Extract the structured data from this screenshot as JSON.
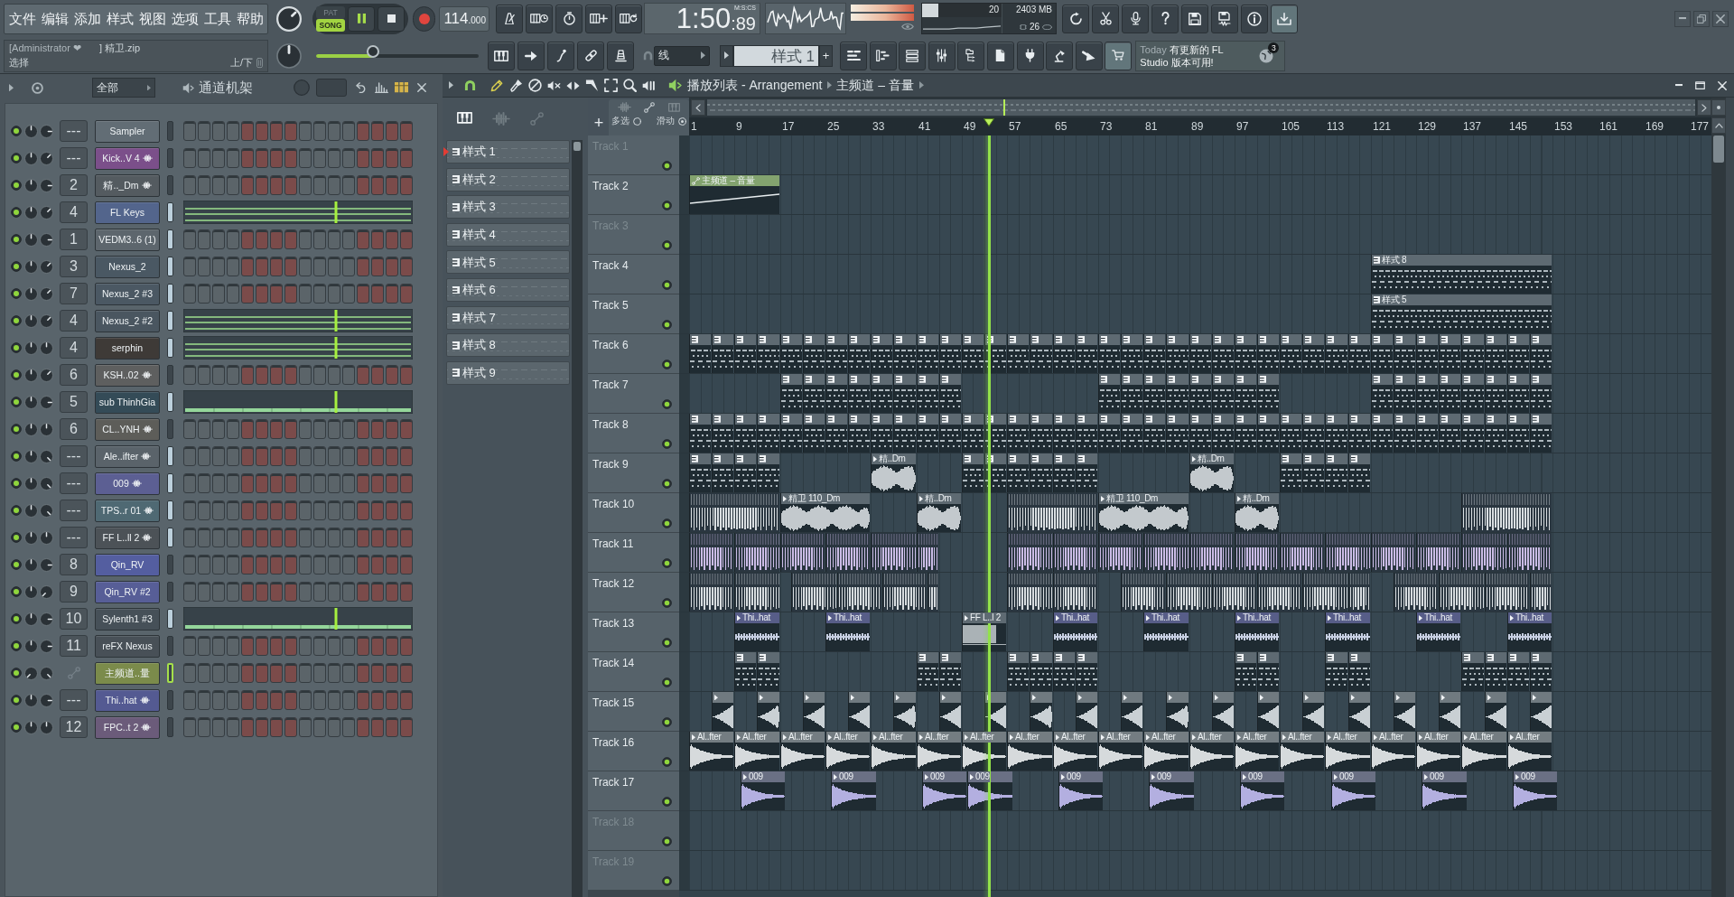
{
  "menu": [
    "文件",
    "编辑",
    "添加",
    "样式",
    "视图",
    "选项",
    "工具",
    "帮助"
  ],
  "hint": {
    "user": "[Administrator ❤",
    "file": "] 精卫.zip",
    "action": "选择",
    "keys": "上/下"
  },
  "master_volume": {
    "kind": "northeast"
  },
  "master_pitch": {
    "kind": "north"
  },
  "master_slider": {
    "level": 0.35
  },
  "transport": {
    "modes": [
      {
        "label": "PAT",
        "selected": false
      },
      {
        "label": "SONG",
        "selected": true
      }
    ],
    "playing": true
  },
  "tempo": {
    "value": "114",
    "fraction": ".000"
  },
  "time": {
    "value": "1:50",
    "fraction": ":89",
    "unit": "M:S:CS"
  },
  "peak_meters": [
    {
      "level": 1
    },
    {
      "level": 1
    }
  ],
  "cpu": {
    "level": 0.2,
    "value": "20",
    "memory": "2403 MB",
    "polyphony": "26"
  },
  "download_button": {
    "highlighted": true
  },
  "store_button": {
    "highlighted": true
  },
  "snap": {
    "value": "线"
  },
  "pattern_picker": {
    "value": "样式 1",
    "add": "+"
  },
  "news": {
    "when": "Today",
    "message": "有更新的 FL Studio 版本可用!",
    "count": "3"
  },
  "channel_rack": {
    "filter": "全部",
    "title": "通道机架",
    "position": {
      "level": 0.67
    },
    "channels": [
      {
        "name": "Sampler",
        "kind": "instrument",
        "mixer": "---",
        "color": "#626d75",
        "enabled": true,
        "pan": {
          "kind": "north"
        },
        "volume": {
          "kind": "east"
        },
        "selected": false,
        "focused": false,
        "preview": {
          "kind": "steps"
        }
      },
      {
        "name": "Kick..V 4",
        "kind": "sample",
        "mixer": "---",
        "color": "#7b4f8a",
        "enabled": true,
        "pan": {
          "kind": "north"
        },
        "volume": {
          "kind": "northeast"
        },
        "selected": false,
        "focused": false,
        "preview": {
          "kind": "steps"
        }
      },
      {
        "name": "精.._Dm",
        "kind": "sample",
        "mixer": "2",
        "color": "#545b60",
        "enabled": true,
        "pan": {
          "kind": "north"
        },
        "volume": {
          "kind": "east"
        },
        "selected": false,
        "focused": false,
        "preview": {
          "kind": "steps"
        }
      },
      {
        "name": "FL Keys",
        "kind": "instrument",
        "mixer": "4",
        "color": "#53658c",
        "enabled": true,
        "pan": {
          "kind": "north"
        },
        "volume": {
          "kind": "northeast"
        },
        "selected": true,
        "focused": false,
        "preview": {
          "kind": "chords"
        }
      },
      {
        "name": "VEDM3..6 (1)",
        "kind": "instrument",
        "mixer": "1",
        "color": "#5d666d",
        "enabled": true,
        "pan": {
          "kind": "north"
        },
        "volume": {
          "kind": "east"
        },
        "selected": true,
        "focused": false,
        "preview": {
          "kind": "steps"
        }
      },
      {
        "name": "Nexus_2",
        "kind": "instrument",
        "mixer": "3",
        "color": "#4a5863",
        "enabled": true,
        "pan": {
          "kind": "north"
        },
        "volume": {
          "kind": "northeast"
        },
        "selected": true,
        "focused": false,
        "preview": {
          "kind": "steps"
        }
      },
      {
        "name": "Nexus_2 #3",
        "kind": "instrument",
        "mixer": "7",
        "color": "#4b5863",
        "enabled": true,
        "pan": {
          "kind": "north"
        },
        "volume": {
          "kind": "northeast"
        },
        "selected": true,
        "focused": false,
        "preview": {
          "kind": "steps"
        }
      },
      {
        "name": "Nexus_2 #2",
        "kind": "instrument",
        "mixer": "4",
        "color": "#4a5660",
        "enabled": true,
        "pan": {
          "kind": "north"
        },
        "volume": {
          "kind": "northeast"
        },
        "selected": true,
        "focused": false,
        "preview": {
          "kind": "chords"
        }
      },
      {
        "name": "serphin",
        "kind": "instrument",
        "mixer": "4",
        "color": "#3e3a37",
        "enabled": true,
        "pan": {
          "kind": "north"
        },
        "volume": {
          "kind": "north"
        },
        "selected": true,
        "focused": false,
        "preview": {
          "kind": "chords"
        }
      },
      {
        "name": "KSH..02",
        "kind": "sample",
        "mixer": "6",
        "color": "#5e5f5f",
        "enabled": true,
        "pan": {
          "kind": "north"
        },
        "volume": {
          "kind": "northeast"
        },
        "selected": false,
        "focused": false,
        "preview": {
          "kind": "steps"
        }
      },
      {
        "name": "sub ThinhGia",
        "kind": "instrument",
        "mixer": "5",
        "color": "#344b57",
        "enabled": true,
        "pan": {
          "kind": "north"
        },
        "volume": {
          "kind": "east"
        },
        "selected": true,
        "focused": false,
        "preview": {
          "kind": "bass"
        }
      },
      {
        "name": "CL..YNH",
        "kind": "sample",
        "mixer": "6",
        "color": "#5d5d59",
        "enabled": true,
        "pan": {
          "kind": "north"
        },
        "volume": {
          "kind": "north"
        },
        "selected": false,
        "focused": false,
        "preview": {
          "kind": "steps"
        }
      },
      {
        "name": "Ale..ifter",
        "kind": "sample",
        "mixer": "---",
        "color": "#5a636a",
        "enabled": true,
        "pan": {
          "kind": "north"
        },
        "volume": {
          "kind": "southeast"
        },
        "selected": true,
        "focused": false,
        "preview": {
          "kind": "steps"
        }
      },
      {
        "name": "009",
        "kind": "sample",
        "mixer": "---",
        "color": "#5c5f93",
        "enabled": true,
        "pan": {
          "kind": "north"
        },
        "volume": {
          "kind": "southeast"
        },
        "selected": true,
        "focused": false,
        "preview": {
          "kind": "steps"
        }
      },
      {
        "name": "TPS..r 01",
        "kind": "sample",
        "mixer": "---",
        "color": "#4f6973",
        "enabled": true,
        "pan": {
          "kind": "north"
        },
        "volume": {
          "kind": "southeast"
        },
        "selected": true,
        "focused": false,
        "preview": {
          "kind": "steps"
        }
      },
      {
        "name": "FF L..ll 2",
        "kind": "sample",
        "mixer": "---",
        "color": "#4c5257",
        "enabled": true,
        "pan": {
          "kind": "north"
        },
        "volume": {
          "kind": "north"
        },
        "selected": true,
        "focused": false,
        "preview": {
          "kind": "steps"
        }
      },
      {
        "name": "Qin_RV",
        "kind": "instrument",
        "mixer": "8",
        "color": "#545ea0",
        "enabled": true,
        "pan": {
          "kind": "north"
        },
        "volume": {
          "kind": "east"
        },
        "selected": false,
        "focused": false,
        "preview": {
          "kind": "steps"
        }
      },
      {
        "name": "Qin_RV #2",
        "kind": "instrument",
        "mixer": "9",
        "color": "#575e97",
        "enabled": true,
        "pan": {
          "kind": "north"
        },
        "volume": {
          "kind": "southwest"
        },
        "selected": false,
        "focused": false,
        "preview": {
          "kind": "steps"
        }
      },
      {
        "name": "Sylenth1 #3",
        "kind": "instrument",
        "mixer": "10",
        "color": "#465058",
        "enabled": true,
        "pan": {
          "kind": "north"
        },
        "volume": {
          "kind": "east"
        },
        "selected": true,
        "focused": false,
        "preview": {
          "kind": "bass"
        }
      },
      {
        "name": "reFX Nexus",
        "kind": "instrument",
        "mixer": "11",
        "color": "#485057",
        "enabled": true,
        "pan": {
          "kind": "north"
        },
        "volume": {
          "kind": "east"
        },
        "selected": false,
        "focused": false,
        "preview": {
          "kind": "steps"
        }
      },
      {
        "name": "主频道..量",
        "kind": "automation",
        "color": "#7b8b4b",
        "enabled": true,
        "pan": {
          "kind": "southwest"
        },
        "volume": {
          "kind": "southeast"
        },
        "selected": false,
        "focused": true,
        "preview": {
          "kind": "steps"
        }
      },
      {
        "name": "Thi..hat",
        "kind": "sample",
        "mixer": "---",
        "color": "#545a92",
        "enabled": true,
        "pan": {
          "kind": "north"
        },
        "volume": {
          "kind": "east"
        },
        "selected": false,
        "focused": false,
        "preview": {
          "kind": "steps"
        }
      },
      {
        "name": "FPC..t 2",
        "kind": "sample",
        "mixer": "12",
        "color": "#6b5b7a",
        "enabled": true,
        "pan": {
          "kind": "north"
        },
        "volume": {
          "kind": "north"
        },
        "selected": false,
        "focused": false,
        "preview": {
          "kind": "steps"
        }
      }
    ]
  },
  "playlist": {
    "title": "播放列表 - Arrangement",
    "breadcrumb": "主频道 – 音量",
    "tools": [
      {
        "kind": "draw",
        "selected": true
      },
      {
        "kind": "paint",
        "selected": false
      },
      {
        "kind": "delete",
        "selected": false
      },
      {
        "kind": "mute",
        "selected": false
      },
      {
        "kind": "slip",
        "selected": false
      },
      {
        "kind": "slice",
        "selected": false
      },
      {
        "kind": "select",
        "selected": false
      },
      {
        "kind": "zoom",
        "selected": false
      },
      {
        "kind": "playback",
        "selected": false
      }
    ],
    "filters": [
      {
        "kind": "pattern",
        "selected": true
      },
      {
        "kind": "audio",
        "selected": false
      },
      {
        "kind": "automation",
        "selected": false
      }
    ],
    "patterns": [
      {
        "name": "样式 1",
        "selected": true
      },
      {
        "name": "样式 2",
        "selected": false
      },
      {
        "name": "样式 3",
        "selected": false
      },
      {
        "name": "样式 4",
        "selected": false
      },
      {
        "name": "样式 5",
        "selected": false
      },
      {
        "name": "样式 6",
        "selected": false
      },
      {
        "name": "样式 7",
        "selected": false
      },
      {
        "name": "样式 8",
        "selected": false
      },
      {
        "name": "样式 9",
        "selected": false
      }
    ],
    "add_track": "+",
    "multi_select": "多选",
    "slide": "滑动",
    "ruler": [
      "1",
      "9",
      "17",
      "25",
      "33",
      "41",
      "49",
      "57",
      "65",
      "73",
      "81",
      "89",
      "97",
      "105",
      "113",
      "121",
      "129",
      "137",
      "145",
      "153",
      "161",
      "169",
      "177"
    ],
    "song_position": {
      "level": 0.3
    },
    "tracks": [
      {
        "name": "Track 1",
        "enabled": true
      },
      {
        "name": "Track 2",
        "enabled": true,
        "clips": [
          {
            "kind": "automation",
            "label": "主频道 – 音量",
            "color": "#83a36f"
          }
        ]
      },
      {
        "name": "Track 3",
        "enabled": true
      },
      {
        "name": "Track 4",
        "enabled": true,
        "clips": [
          {
            "kind": "pattern",
            "label": "样式 8"
          }
        ]
      },
      {
        "name": "Track 5",
        "enabled": true,
        "clips": [
          {
            "kind": "pattern",
            "label": "样式 5"
          }
        ]
      },
      {
        "name": "Track 6",
        "enabled": true,
        "clips": [
          {
            "kind": "pattern"
          },
          {
            "kind": "pattern"
          },
          {
            "kind": "pattern"
          },
          {
            "kind": "pattern"
          },
          {
            "kind": "pattern"
          },
          {
            "kind": "pattern"
          },
          {
            "kind": "pattern"
          },
          {
            "kind": "pattern"
          },
          {
            "kind": "pattern"
          },
          {
            "kind": "pattern"
          },
          {
            "kind": "pattern"
          },
          {
            "kind": "pattern"
          },
          {
            "kind": "pattern"
          },
          {
            "kind": "pattern"
          },
          {
            "kind": "pattern"
          },
          {
            "kind": "pattern"
          },
          {
            "kind": "pattern"
          },
          {
            "kind": "pattern"
          },
          {
            "kind": "pattern"
          },
          {
            "kind": "pattern"
          },
          {
            "kind": "pattern"
          },
          {
            "kind": "pattern"
          },
          {
            "kind": "pattern"
          },
          {
            "kind": "pattern"
          },
          {
            "kind": "pattern"
          },
          {
            "kind": "pattern"
          },
          {
            "kind": "pattern"
          },
          {
            "kind": "pattern"
          },
          {
            "kind": "pattern"
          },
          {
            "kind": "pattern"
          },
          {
            "kind": "pattern"
          },
          {
            "kind": "pattern"
          },
          {
            "kind": "pattern"
          },
          {
            "kind": "pattern"
          },
          {
            "kind": "pattern"
          },
          {
            "kind": "pattern"
          },
          {
            "kind": "pattern"
          },
          {
            "kind": "pattern"
          }
        ]
      },
      {
        "name": "Track 7",
        "enabled": true,
        "clips": [
          {
            "kind": "pattern"
          },
          {
            "kind": "pattern"
          },
          {
            "kind": "pattern"
          },
          {
            "kind": "pattern"
          },
          {
            "kind": "pattern"
          },
          {
            "kind": "pattern"
          },
          {
            "kind": "pattern"
          },
          {
            "kind": "pattern"
          },
          {
            "kind": "pattern"
          },
          {
            "kind": "pattern"
          },
          {
            "kind": "pattern"
          },
          {
            "kind": "pattern"
          },
          {
            "kind": "pattern"
          },
          {
            "kind": "pattern"
          },
          {
            "kind": "pattern"
          },
          {
            "kind": "pattern"
          },
          {
            "kind": "pattern"
          },
          {
            "kind": "pattern"
          },
          {
            "kind": "pattern"
          },
          {
            "kind": "pattern"
          },
          {
            "kind": "pattern"
          },
          {
            "kind": "pattern"
          },
          {
            "kind": "pattern"
          },
          {
            "kind": "pattern"
          }
        ]
      },
      {
        "name": "Track 8",
        "enabled": true,
        "clips": [
          {
            "kind": "pattern"
          },
          {
            "kind": "pattern"
          },
          {
            "kind": "pattern"
          },
          {
            "kind": "pattern"
          },
          {
            "kind": "pattern"
          },
          {
            "kind": "pattern"
          },
          {
            "kind": "pattern"
          },
          {
            "kind": "pattern"
          },
          {
            "kind": "pattern"
          },
          {
            "kind": "pattern"
          },
          {
            "kind": "pattern"
          },
          {
            "kind": "pattern"
          },
          {
            "kind": "pattern"
          },
          {
            "kind": "pattern"
          },
          {
            "kind": "pattern"
          },
          {
            "kind": "pattern"
          },
          {
            "kind": "pattern"
          },
          {
            "kind": "pattern"
          },
          {
            "kind": "pattern"
          },
          {
            "kind": "pattern"
          },
          {
            "kind": "pattern"
          },
          {
            "kind": "pattern"
          },
          {
            "kind": "pattern"
          },
          {
            "kind": "pattern"
          },
          {
            "kind": "pattern"
          },
          {
            "kind": "pattern"
          },
          {
            "kind": "pattern"
          },
          {
            "kind": "pattern"
          },
          {
            "kind": "pattern"
          },
          {
            "kind": "pattern"
          },
          {
            "kind": "pattern"
          },
          {
            "kind": "pattern"
          },
          {
            "kind": "pattern"
          },
          {
            "kind": "pattern"
          },
          {
            "kind": "pattern"
          },
          {
            "kind": "pattern"
          },
          {
            "kind": "pattern"
          },
          {
            "kind": "pattern"
          }
        ]
      },
      {
        "name": "Track 9",
        "enabled": true,
        "clips": [
          {
            "kind": "pattern"
          },
          {
            "kind": "pattern"
          },
          {
            "kind": "pattern"
          },
          {
            "kind": "pattern"
          },
          {
            "kind": "loop",
            "label": "精..Dm"
          },
          {
            "kind": "pattern"
          },
          {
            "kind": "pattern"
          },
          {
            "kind": "pattern"
          },
          {
            "kind": "pattern"
          },
          {
            "kind": "pattern"
          },
          {
            "kind": "pattern"
          },
          {
            "kind": "loop",
            "label": "精..Dm"
          },
          {
            "kind": "pattern"
          },
          {
            "kind": "pattern"
          },
          {
            "kind": "pattern"
          },
          {
            "kind": "pattern"
          }
        ]
      },
      {
        "name": "Track 10",
        "enabled": true,
        "clips": [
          {
            "kind": "chop",
            "color": "#d9dee1"
          },
          {
            "kind": "loop",
            "label": "精卫 110_Dm"
          },
          {
            "kind": "loop",
            "label": "精..Dm"
          },
          {
            "kind": "chop",
            "color": "#d9dee1"
          },
          {
            "kind": "loop",
            "label": "精卫 110_Dm"
          },
          {
            "kind": "loop",
            "label": "精..Dm"
          },
          {
            "kind": "chop",
            "color": "#d9dee1"
          }
        ]
      },
      {
        "name": "Track 11",
        "enabled": true,
        "clips": [
          {
            "kind": "chop",
            "color": "#cbbce6"
          },
          {
            "kind": "chop",
            "color": "#cbbce6"
          },
          {
            "kind": "chop",
            "color": "#cbbce6"
          },
          {
            "kind": "chop",
            "color": "#cbbce6"
          },
          {
            "kind": "chop",
            "color": "#cbbce6"
          },
          {
            "kind": "chop",
            "color": "#cbbce6"
          },
          {
            "kind": "chop",
            "color": "#cbbce6"
          },
          {
            "kind": "chop",
            "color": "#cbbce6"
          },
          {
            "kind": "chop",
            "color": "#cbbce6"
          },
          {
            "kind": "chop",
            "color": "#cbbce6"
          },
          {
            "kind": "chop",
            "color": "#cbbce6"
          },
          {
            "kind": "chop",
            "color": "#cbbce6"
          },
          {
            "kind": "chop",
            "color": "#cbbce6"
          },
          {
            "kind": "chop",
            "color": "#cbbce6"
          },
          {
            "kind": "chop",
            "color": "#cbbce6"
          },
          {
            "kind": "chop",
            "color": "#cbbce6"
          },
          {
            "kind": "chop",
            "color": "#cbbce6"
          },
          {
            "kind": "chop",
            "color": "#cbbce6"
          }
        ]
      },
      {
        "name": "Track 12",
        "enabled": true,
        "clips": [
          {
            "kind": "chop",
            "color": "#d7dcdf"
          },
          {
            "kind": "chop",
            "color": "#d7dcdf"
          },
          {
            "kind": "chop",
            "color": "#d7dcdf"
          },
          {
            "kind": "chop",
            "color": "#d7dcdf"
          },
          {
            "kind": "chop",
            "color": "#d7dcdf"
          },
          {
            "kind": "chop",
            "color": "#d7dcdf"
          },
          {
            "kind": "chop",
            "color": "#d7dcdf"
          },
          {
            "kind": "chop",
            "color": "#d7dcdf"
          },
          {
            "kind": "chop",
            "color": "#d7dcdf"
          },
          {
            "kind": "chop",
            "color": "#d7dcdf"
          },
          {
            "kind": "chop",
            "color": "#d7dcdf"
          },
          {
            "kind": "chop",
            "color": "#d7dcdf"
          },
          {
            "kind": "chop",
            "color": "#d7dcdf"
          },
          {
            "kind": "chop",
            "color": "#d7dcdf"
          },
          {
            "kind": "chop",
            "color": "#d7dcdf"
          },
          {
            "kind": "chop",
            "color": "#d7dcdf"
          },
          {
            "kind": "chop",
            "color": "#d7dcdf"
          },
          {
            "kind": "chop",
            "color": "#d7dcdf"
          }
        ]
      },
      {
        "name": "Track 13",
        "enabled": true,
        "clips": [
          {
            "kind": "pulse",
            "label": "Thi..hat"
          },
          {
            "kind": "pulse",
            "label": "Thi..hat"
          },
          {
            "kind": "block",
            "label": "FF L..l 2"
          },
          {
            "kind": "pulse",
            "label": "Thi..hat"
          },
          {
            "kind": "pulse",
            "label": "Thi..hat"
          },
          {
            "kind": "pulse",
            "label": "Thi..hat"
          },
          {
            "kind": "pulse",
            "label": "Thi..hat"
          },
          {
            "kind": "pulse",
            "label": "Thi..hat"
          },
          {
            "kind": "pulse",
            "label": "Thi..hat"
          }
        ]
      },
      {
        "name": "Track 14",
        "enabled": true,
        "clips": [
          {
            "kind": "pattern"
          },
          {
            "kind": "pattern"
          },
          {
            "kind": "pattern"
          },
          {
            "kind": "pattern"
          },
          {
            "kind": "pattern"
          },
          {
            "kind": "pattern"
          },
          {
            "kind": "pattern"
          },
          {
            "kind": "pattern"
          },
          {
            "kind": "pattern"
          },
          {
            "kind": "pattern"
          },
          {
            "kind": "pattern"
          },
          {
            "kind": "pattern"
          },
          {
            "kind": "pattern"
          },
          {
            "kind": "pattern"
          },
          {
            "kind": "pattern"
          },
          {
            "kind": "pattern"
          }
        ]
      },
      {
        "name": "Track 15",
        "enabled": true,
        "clips": [
          {
            "kind": "rise",
            "color": "#c9d0d4"
          },
          {
            "kind": "rise",
            "color": "#c9d0d4"
          },
          {
            "kind": "rise",
            "color": "#c9d0d4"
          },
          {
            "kind": "rise",
            "color": "#c9d0d4"
          },
          {
            "kind": "rise",
            "color": "#c9d0d4"
          },
          {
            "kind": "rise",
            "color": "#c9d0d4"
          },
          {
            "kind": "rise",
            "color": "#c9d0d4"
          },
          {
            "kind": "rise",
            "color": "#c9d0d4"
          },
          {
            "kind": "rise",
            "color": "#c9d0d4"
          },
          {
            "kind": "rise",
            "color": "#c9d0d4"
          },
          {
            "kind": "rise",
            "color": "#c9d0d4"
          },
          {
            "kind": "rise",
            "color": "#c9d0d4"
          },
          {
            "kind": "rise",
            "color": "#c9d0d4"
          },
          {
            "kind": "rise",
            "color": "#c9d0d4"
          },
          {
            "kind": "rise",
            "color": "#c9d0d4"
          },
          {
            "kind": "rise",
            "color": "#c9d0d4"
          },
          {
            "kind": "rise",
            "color": "#c9d0d4"
          },
          {
            "kind": "rise",
            "color": "#c9d0d4"
          },
          {
            "kind": "rise",
            "color": "#c9d0d4"
          }
        ]
      },
      {
        "name": "Track 16",
        "enabled": true,
        "clips": [
          {
            "kind": "oneshot",
            "label": "Al..fter",
            "color": "#d6dadc"
          },
          {
            "kind": "oneshot",
            "label": "Al..fter",
            "color": "#d6dadc"
          },
          {
            "kind": "oneshot",
            "label": "Al..fter",
            "color": "#d6dadc"
          },
          {
            "kind": "oneshot",
            "label": "Al..fter",
            "color": "#d6dadc"
          },
          {
            "kind": "oneshot",
            "label": "Al..fter",
            "color": "#d6dadc"
          },
          {
            "kind": "oneshot",
            "label": "Al..fter",
            "color": "#d6dadc"
          },
          {
            "kind": "oneshot",
            "label": "Al..fter",
            "color": "#d6dadc"
          },
          {
            "kind": "oneshot",
            "label": "Al..fter",
            "color": "#d6dadc"
          },
          {
            "kind": "oneshot",
            "label": "Al..fter",
            "color": "#d6dadc"
          },
          {
            "kind": "oneshot",
            "label": "Al..fter",
            "color": "#d6dadc"
          },
          {
            "kind": "oneshot",
            "label": "Al..fter",
            "color": "#d6dadc"
          },
          {
            "kind": "oneshot",
            "label": "Al..fter",
            "color": "#d6dadc"
          },
          {
            "kind": "oneshot",
            "label": "Al..fter",
            "color": "#d6dadc"
          },
          {
            "kind": "oneshot",
            "label": "Al..fter",
            "color": "#d6dadc"
          },
          {
            "kind": "oneshot",
            "label": "Al..fter",
            "color": "#d6dadc"
          },
          {
            "kind": "oneshot",
            "label": "Al..fter",
            "color": "#d6dadc"
          },
          {
            "kind": "oneshot",
            "label": "Al..fter",
            "color": "#d6dadc"
          },
          {
            "kind": "oneshot",
            "label": "Al..fter",
            "color": "#d6dadc"
          },
          {
            "kind": "oneshot",
            "label": "Al..fter",
            "color": "#d6dadc"
          }
        ]
      },
      {
        "name": "Track 17",
        "enabled": true,
        "clips": [
          {
            "kind": "oneshot",
            "label": "009",
            "color": "#b3afe0"
          },
          {
            "kind": "oneshot",
            "label": "009",
            "color": "#b3afe0"
          },
          {
            "kind": "oneshot",
            "label": "009",
            "color": "#b3afe0"
          },
          {
            "kind": "oneshot",
            "label": "009",
            "color": "#b3afe0"
          },
          {
            "kind": "oneshot",
            "label": "009",
            "color": "#b3afe0"
          },
          {
            "kind": "oneshot",
            "label": "009",
            "color": "#b3afe0"
          },
          {
            "kind": "oneshot",
            "label": "009",
            "color": "#b3afe0"
          },
          {
            "kind": "oneshot",
            "label": "009",
            "color": "#b3afe0"
          },
          {
            "kind": "oneshot",
            "label": "009",
            "color": "#b3afe0"
          },
          {
            "kind": "oneshot",
            "label": "009",
            "color": "#b3afe0"
          }
        ]
      },
      {
        "name": "Track 18",
        "enabled": true
      },
      {
        "name": "Track 19",
        "enabled": true
      }
    ]
  }
}
